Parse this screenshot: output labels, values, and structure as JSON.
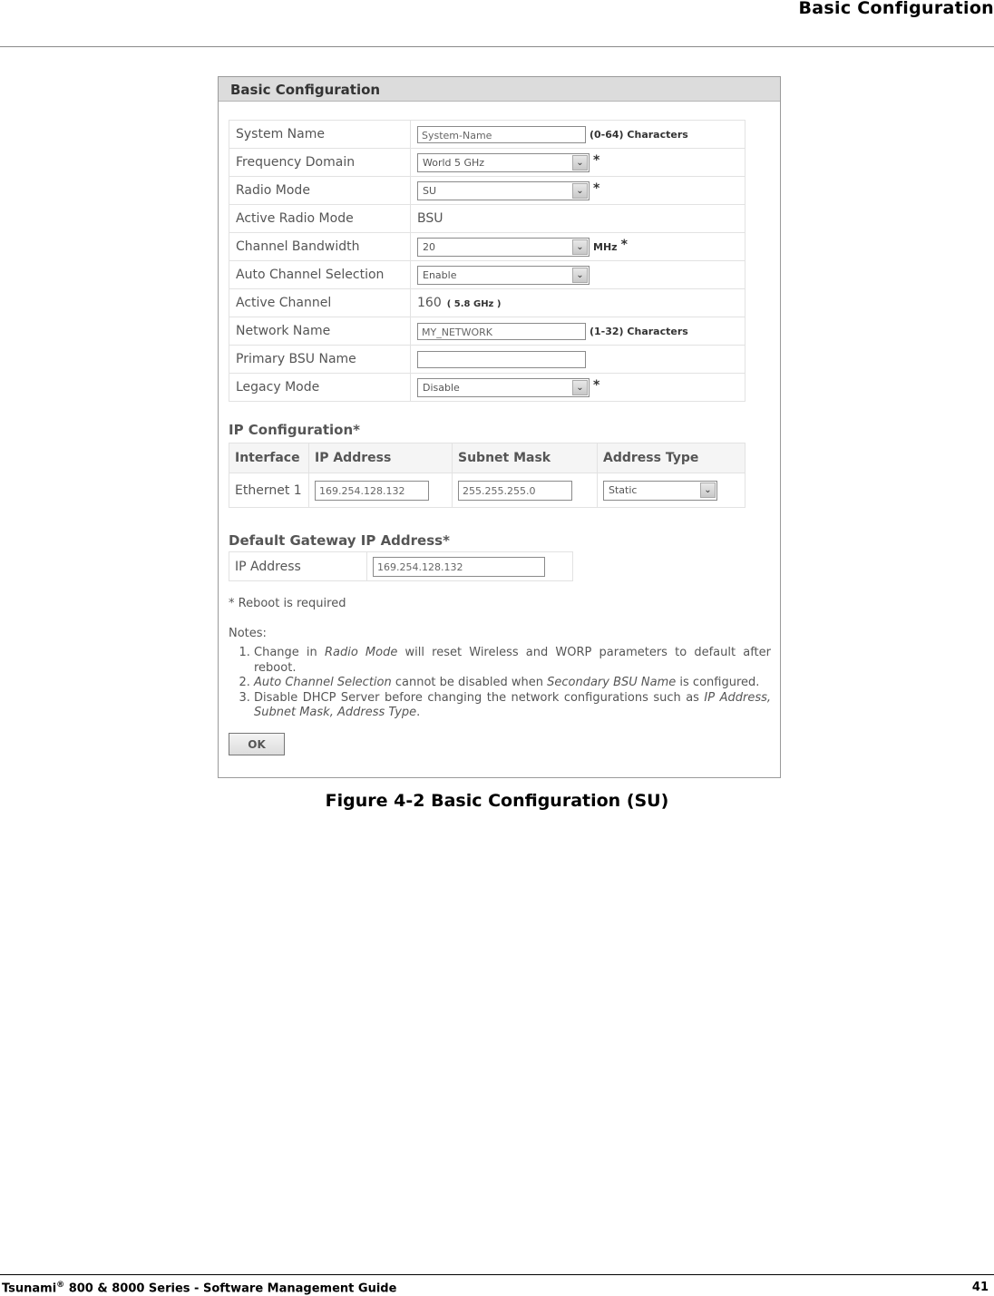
{
  "page_header": {
    "title": "Basic Configuration"
  },
  "figure": {
    "panel_title": "Basic Configuration",
    "rows": [
      {
        "label": "System Name",
        "type": "input",
        "value": "System-Name",
        "hint": "(0-64) Characters",
        "star": ""
      },
      {
        "label": "Frequency Domain",
        "type": "select",
        "value": "World 5 GHz",
        "hint": "",
        "star": "*"
      },
      {
        "label": "Radio Mode",
        "type": "select",
        "value": "SU",
        "hint": "",
        "star": "*"
      },
      {
        "label": "Active Radio Mode",
        "type": "text",
        "value": "BSU",
        "hint": "",
        "star": ""
      },
      {
        "label": "Channel Bandwidth",
        "type": "select",
        "value": "20",
        "hint": "MHz",
        "star": "*"
      },
      {
        "label": "Auto Channel Selection",
        "type": "select",
        "value": "Enable",
        "hint": "",
        "star": ""
      },
      {
        "label": "Active Channel",
        "type": "text",
        "value": "160",
        "sub": "( 5.8 GHz )",
        "hint": "",
        "star": ""
      },
      {
        "label": "Network Name",
        "type": "input",
        "value": "MY_NETWORK",
        "hint": "(1-32) Characters",
        "star": ""
      },
      {
        "label": "Primary BSU Name",
        "type": "input",
        "value": "",
        "hint": "",
        "star": ""
      },
      {
        "label": "Legacy Mode",
        "type": "select",
        "value": "Disable",
        "hint": "",
        "star": "*"
      }
    ],
    "ip_config": {
      "title": "IP Configuration*",
      "headers": [
        "Interface",
        "IP Address",
        "Subnet Mask",
        "Address Type"
      ],
      "row": {
        "interface": "Ethernet 1",
        "ip": "169.254.128.132",
        "mask": "255.255.255.0",
        "type": "Static"
      }
    },
    "gateway": {
      "title": "Default Gateway IP Address*",
      "label": "IP Address",
      "value": "169.254.128.132"
    },
    "reboot_note": "* Reboot is required",
    "notes_label": "Notes:",
    "notes": [
      {
        "parts": [
          [
            "Change in ",
            false
          ],
          [
            "Radio Mode",
            true
          ],
          [
            " will reset Wireless and WORP parameters to default after reboot.",
            false
          ]
        ]
      },
      {
        "parts": [
          [
            "Auto Channel Selection",
            true
          ],
          [
            " cannot be disabled when ",
            false
          ],
          [
            "Secondary BSU Name",
            true
          ],
          [
            " is configured.",
            false
          ]
        ]
      },
      {
        "parts": [
          [
            "Disable DHCP Server before changing the network configurations such as ",
            false
          ],
          [
            "IP Address, Subnet Mask, Address Type",
            true
          ],
          [
            ".",
            false
          ]
        ]
      }
    ],
    "ok_label": "OK",
    "caption": "Figure 4-2 Basic Configuration (SU)"
  },
  "page_footer": {
    "product": "Tsunami",
    "reg": "®",
    "title_rest": " 800 & 8000 Series - Software Management Guide",
    "page_number": "41"
  },
  "icons": {
    "dropdown": "chevron-down-icon"
  }
}
